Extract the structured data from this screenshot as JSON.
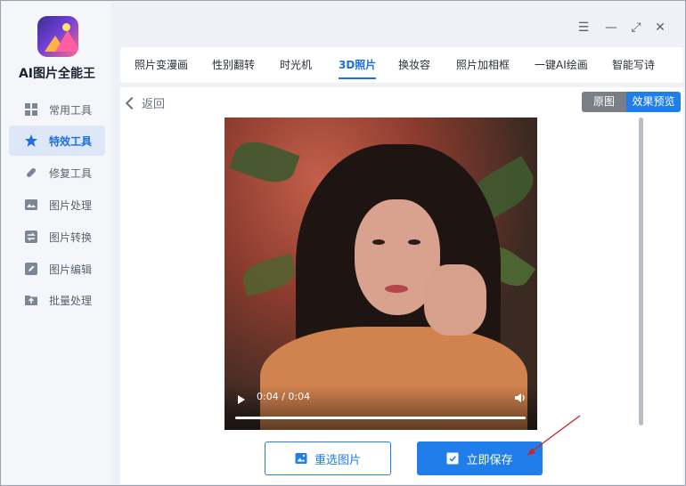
{
  "app": {
    "title": "AI图片全能王"
  },
  "sidebar": {
    "items": [
      {
        "label": "常用工具",
        "icon": "grid-icon",
        "active": false
      },
      {
        "label": "特效工具",
        "icon": "star-icon",
        "active": true
      },
      {
        "label": "修复工具",
        "icon": "bandage-icon",
        "active": false
      },
      {
        "label": "图片处理",
        "icon": "image-icon",
        "active": false
      },
      {
        "label": "图片转换",
        "icon": "convert-icon",
        "active": false
      },
      {
        "label": "图片编辑",
        "icon": "edit-icon",
        "active": false
      },
      {
        "label": "批量处理",
        "icon": "folder-upload-icon",
        "active": false
      }
    ]
  },
  "window": {
    "menu": "☰",
    "minimize": "—",
    "maximize": "⤢",
    "close": "✕"
  },
  "tabs": [
    {
      "label": "照片变漫画"
    },
    {
      "label": "性别翻转"
    },
    {
      "label": "时光机"
    },
    {
      "label": "3D照片",
      "active": true
    },
    {
      "label": "换妆容"
    },
    {
      "label": "照片加相框"
    },
    {
      "label": "一键AI绘画"
    },
    {
      "label": "智能写诗"
    }
  ],
  "content": {
    "back_label": "返回",
    "view_original": "原图",
    "view_preview": "效果预览",
    "video": {
      "time": "0:04 / 0:04",
      "progress": 1.0
    },
    "reselect_label": "重选图片",
    "save_label": "立即保存"
  },
  "colors": {
    "accent": "#1f7ee9",
    "active_bg": "#dde7f8",
    "annotation_arrow": "#c0272d"
  }
}
